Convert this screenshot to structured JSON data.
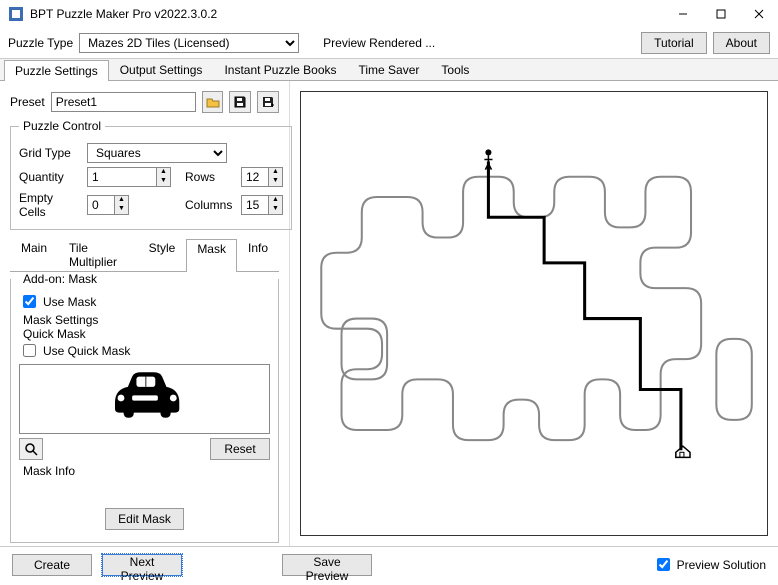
{
  "window": {
    "title": "BPT Puzzle Maker Pro v2022.3.0.2"
  },
  "top": {
    "puzzle_type_label": "Puzzle Type",
    "puzzle_type_value": "Mazes 2D Tiles (Licensed)",
    "preview_label": "Preview Rendered ...",
    "tutorial": "Tutorial",
    "about": "About"
  },
  "tabs": {
    "main": [
      "Puzzle Settings",
      "Output Settings",
      "Instant Puzzle Books",
      "Time Saver",
      "Tools"
    ],
    "active": 0
  },
  "preset": {
    "label": "Preset",
    "value": "Preset1"
  },
  "puzzle_control": {
    "legend": "Puzzle Control",
    "grid_type_label": "Grid Type",
    "grid_type_value": "Squares",
    "quantity_label": "Quantity",
    "quantity_value": "1",
    "rows_label": "Rows",
    "rows_value": "12",
    "empty_label": "Empty Cells",
    "empty_value": "0",
    "cols_label": "Columns",
    "cols_value": "15"
  },
  "subtabs": {
    "items": [
      "Main",
      "Tile Multiplier",
      "Style",
      "Mask",
      "Info"
    ],
    "active": 3
  },
  "mask": {
    "addon_legend": "Add-on: Mask",
    "use_mask_label": "Use Mask",
    "use_mask_checked": true,
    "settings_legend": "Mask Settings",
    "quick_legend": "Quick Mask",
    "use_quick_label": "Use Quick Mask",
    "use_quick_checked": false,
    "reset": "Reset",
    "info_legend": "Mask Info",
    "edit": "Edit Mask",
    "icon_name": "car-icon"
  },
  "bottom": {
    "create": "Create",
    "next_preview": "Next Preview",
    "save_preview": "Save Preview",
    "preview_solution_label": "Preview Solution",
    "preview_solution_checked": true
  }
}
